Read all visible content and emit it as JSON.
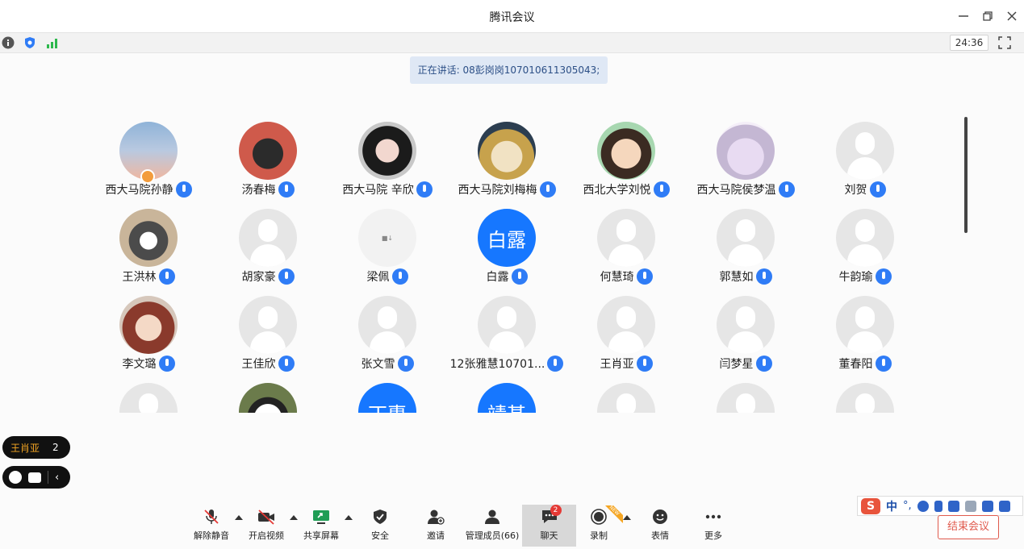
{
  "window": {
    "title": "腾讯会议"
  },
  "status": {
    "timer": "24:36"
  },
  "speaking": {
    "text": "正在讲话: 08彭岗岗107010611305043;"
  },
  "participants": [
    {
      "name": "西大马院孙静",
      "avatar": "photo",
      "style": "p1",
      "host": true
    },
    {
      "name": "汤春梅",
      "avatar": "photo",
      "style": "p2"
    },
    {
      "name": "西大马院 辛欣",
      "avatar": "photo",
      "style": "p3"
    },
    {
      "name": "西大马院刘梅梅",
      "avatar": "photo",
      "style": "p4"
    },
    {
      "name": "西北大学刘悦",
      "avatar": "photo",
      "style": "p5"
    },
    {
      "name": "西大马院侯梦温",
      "avatar": "photo",
      "style": "p6"
    },
    {
      "name": "刘贺",
      "avatar": "blank"
    },
    {
      "name": "王洪林",
      "avatar": "photo",
      "style": "p7"
    },
    {
      "name": "胡家豪",
      "avatar": "blank"
    },
    {
      "name": "梁佩",
      "avatar": "tiny",
      "avatar_text": "■↓"
    },
    {
      "name": "白露",
      "avatar": "text",
      "avatar_text": "白露"
    },
    {
      "name": "何慧琦",
      "avatar": "blank"
    },
    {
      "name": "郭慧如",
      "avatar": "blank"
    },
    {
      "name": "牛韵瑜",
      "avatar": "blank"
    },
    {
      "name": "李文璐",
      "avatar": "photo",
      "style": "p8"
    },
    {
      "name": "王佳欣",
      "avatar": "blank"
    },
    {
      "name": "张文雪",
      "avatar": "blank"
    },
    {
      "name": "12张雅慧10701...",
      "avatar": "blank"
    },
    {
      "name": "王肖亚",
      "avatar": "blank"
    },
    {
      "name": "闫梦星",
      "avatar": "blank"
    },
    {
      "name": "董春阳",
      "avatar": "blank"
    },
    {
      "name": "",
      "avatar": "blank"
    },
    {
      "name": "",
      "avatar": "photo",
      "style": "p9"
    },
    {
      "name": "",
      "avatar": "text",
      "avatar_text": "丁惠"
    },
    {
      "name": "",
      "avatar": "text",
      "avatar_text": "靖甚"
    },
    {
      "name": "",
      "avatar": "blank"
    },
    {
      "name": "",
      "avatar": "blank"
    },
    {
      "name": "",
      "avatar": "blank"
    }
  ],
  "chat_popup": {
    "sender": "王肖亚",
    "count": "2"
  },
  "toolbar": {
    "unmute": "解除静音",
    "start_video": "开启视频",
    "share_screen": "共享屏幕",
    "security": "安全",
    "invite": "邀请",
    "members": "管理成员(66)",
    "chat": "聊天",
    "chat_badge": "2",
    "record": "录制",
    "reactions": "表情",
    "more": "更多",
    "end": "结束会议",
    "new_tag": "NEW"
  },
  "ime": {
    "logo": "S",
    "lang": "中",
    "punct": "°,"
  },
  "colors": {
    "accent": "#2f7cf6",
    "end": "#e05a4d",
    "avatar_blue": "#1677ff"
  }
}
